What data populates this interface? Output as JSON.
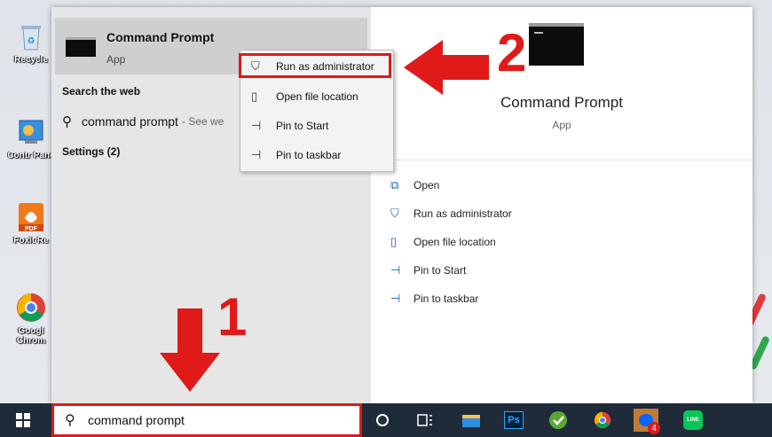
{
  "desktop": {
    "icons": [
      {
        "label": "Recycle",
        "icon": "recycle-bin-icon"
      },
      {
        "label": "Contr Pane",
        "icon": "control-panel-icon"
      },
      {
        "label": "Foxit Re",
        "icon": "foxit-pdf-icon"
      },
      {
        "label": "Googl Chrom",
        "icon": "chrome-icon"
      }
    ]
  },
  "start_menu": {
    "best_match": {
      "title": "Command Prompt",
      "subtitle": "App"
    },
    "search_web_heading": "Search the web",
    "web_result": {
      "query": "command prompt",
      "suffix": "- See we"
    },
    "settings_heading": "Settings (2)",
    "context_menu": [
      {
        "label": "Run as administrator",
        "icon": "shield-icon"
      },
      {
        "label": "Open file location",
        "icon": "folder-icon"
      },
      {
        "label": "Pin to Start",
        "icon": "pin-icon"
      },
      {
        "label": "Pin to taskbar",
        "icon": "pin-icon"
      }
    ],
    "detail": {
      "title": "Command Prompt",
      "subtitle": "App",
      "actions": [
        {
          "label": "Open",
          "icon": "open-icon"
        },
        {
          "label": "Run as administrator",
          "icon": "shield-icon"
        },
        {
          "label": "Open file location",
          "icon": "folder-icon"
        },
        {
          "label": "Pin to Start",
          "icon": "pin-icon"
        },
        {
          "label": "Pin to taskbar",
          "icon": "pin-icon"
        }
      ]
    }
  },
  "annotations": {
    "step1": "1",
    "step2": "2"
  },
  "taskbar": {
    "search_text": "command prompt",
    "items": [
      "cortana-icon",
      "task-view-icon",
      "file-explorer-icon",
      "photoshop-icon",
      "greenshot-icon",
      "chrome-icon",
      "zalo-icon",
      "line-icon"
    ],
    "ps_label": "Ps",
    "zalo_badge": "4",
    "line_label": "LINE"
  },
  "colors": {
    "highlight": "#e01919",
    "taskbar": "#1f2b38",
    "accent": "#1a5fb4"
  }
}
